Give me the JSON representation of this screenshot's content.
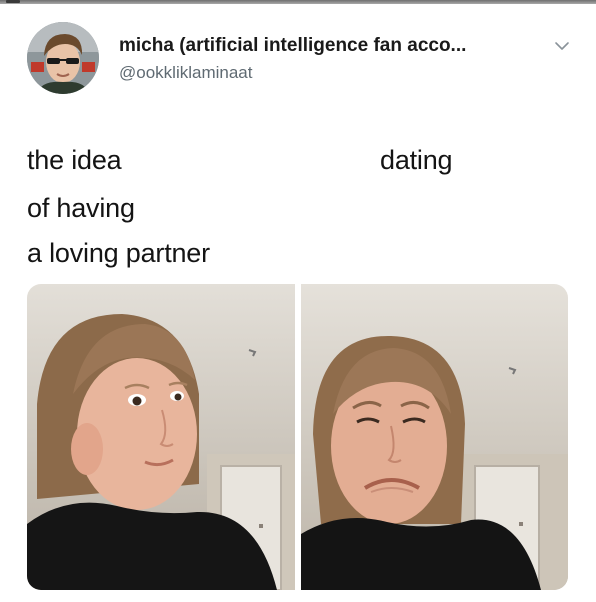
{
  "tweet": {
    "display_name": "micha (artificial intelligence fan acco...",
    "handle": "@ookkliklaminaat",
    "lines_left": [
      "the idea",
      "of having",
      "a loving partner"
    ],
    "line_right": "dating"
  },
  "icons": {
    "more": "chevron-down-icon"
  },
  "colors": {
    "handle": "#5f6a72",
    "text": "#141414"
  }
}
